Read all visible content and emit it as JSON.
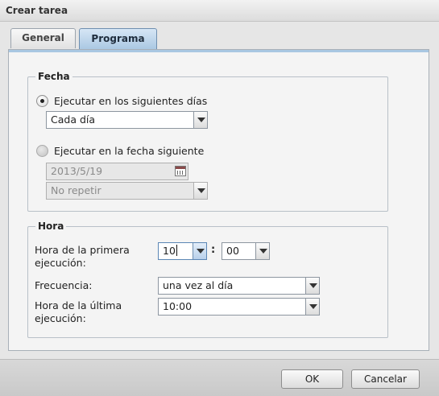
{
  "window": {
    "title": "Crear tarea"
  },
  "tabs": [
    {
      "label": "General",
      "active": false
    },
    {
      "label": "Programa",
      "active": true
    }
  ],
  "fecha": {
    "legend": "Fecha",
    "option_days": {
      "label": "Ejecutar en los siguientes días",
      "checked": true
    },
    "days_select": {
      "value": "Cada día"
    },
    "option_date": {
      "label": "Ejecutar en la fecha siguiente",
      "checked": false
    },
    "date_input": {
      "value": "2013/5/19",
      "enabled": false
    },
    "repeat_select": {
      "value": "No repetir",
      "enabled": false
    }
  },
  "hora": {
    "legend": "Hora",
    "first_run_label": "Hora de la primera ejecución:",
    "first_run_label_line1": "Hora de la primera",
    "first_run_label_line2": "ejecución:",
    "hour_select": {
      "value": "10"
    },
    "separator": ":",
    "minute_select": {
      "value": "00"
    },
    "frequency_label": "Frecuencia:",
    "frequency_select": {
      "value": "una vez al día"
    },
    "last_run_label_line1": "Hora de la última",
    "last_run_label_line2": "ejecución:",
    "last_run_select": {
      "value": "10:00"
    }
  },
  "footer": {
    "ok_label": "OK",
    "cancel_label": "Cancelar"
  },
  "colors": {
    "active_tab": "#a9c7e2",
    "panel_border": "#a8b0b8",
    "dialog_bg": "#e6e6e6"
  }
}
